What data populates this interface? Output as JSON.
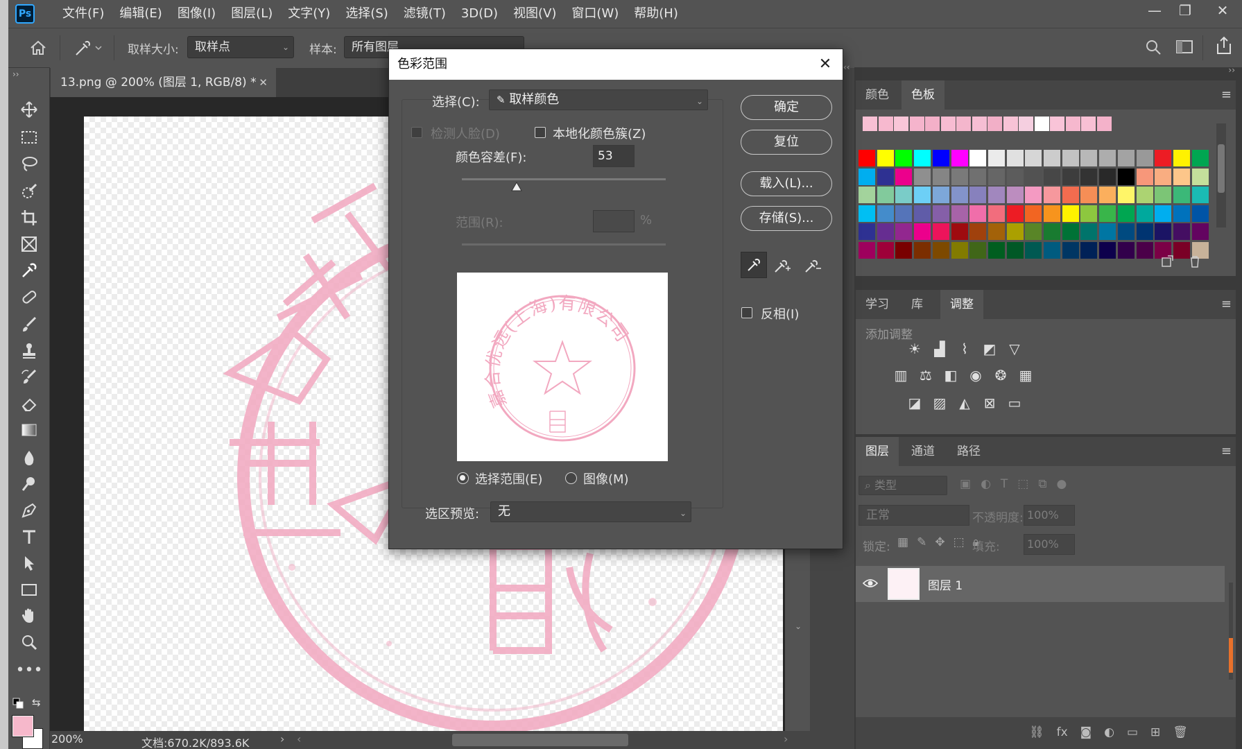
{
  "menubar": {
    "logo": "Ps",
    "items": [
      "文件(F)",
      "编辑(E)",
      "图像(I)",
      "图层(L)",
      "文字(Y)",
      "选择(S)",
      "滤镜(T)",
      "3D(D)",
      "视图(V)",
      "窗口(W)",
      "帮助(H)"
    ]
  },
  "options": {
    "sample_size_label": "取样大小:",
    "sample_size_value": "取样点",
    "sample_label": "样本:",
    "sample_value": "所有图层"
  },
  "document": {
    "tab_title": "13.png @ 200% (图层 1, RGB/8) *",
    "zoom": "200%",
    "doc_info": "文档:670.2K/893.6K"
  },
  "dialog": {
    "title": "色彩范围",
    "select_label": "选择(C):",
    "select_value": "取样颜色",
    "detect_faces": "检测人脸(D)",
    "localized_clusters": "本地化颜色簇(Z)",
    "fuzziness_label": "颜色容差(F):",
    "fuzziness_value": "53",
    "fuzziness_fraction": 0.27,
    "range_label": "范围(R):",
    "range_unit": "%",
    "radio_selection": "选择范围(E)",
    "radio_image": "图像(M)",
    "preview_label": "选区预览:",
    "preview_value": "无",
    "btn_ok": "确定",
    "btn_reset": "复位",
    "btn_load": "载入(L)...",
    "btn_save": "存储(S)...",
    "invert": "反相(I)"
  },
  "swatch_panel": {
    "tabs": [
      "颜色",
      "色板"
    ],
    "recent": [
      "#f8c0d4",
      "#f7b9cf",
      "#f9c6d8",
      "#f5b4cc",
      "#f3b0c8",
      "#f7bcd2",
      "#f4b6cc",
      "#f6bed3",
      "#f2afc7",
      "#f8c3d6",
      "#f5cfe0",
      "#ffffff",
      "#f9c4d8",
      "#f6b8ce",
      "#f8c0d4",
      "#f4b2ca"
    ],
    "grid": [
      [
        "#ff0000",
        "#ffff00",
        "#00ff00",
        "#00ffff",
        "#0000ff",
        "#ff00ff",
        "#ffffff",
        "#ebebeb",
        "#e0e0e0",
        "#d6d6d6",
        "#cccccc",
        "#c2c2c2",
        "#b8b8b8",
        "#adadad",
        "#a3a3a3",
        "#999999",
        "#ed1c24",
        "#fff200",
        "#00a651"
      ],
      [
        "#00aeef",
        "#2e3192",
        "#ec008c",
        "#8f8f8f",
        "#858585",
        "#7a7a7a",
        "#707070",
        "#666666",
        "#5c5c5c",
        "#525252",
        "#474747",
        "#3d3d3d",
        "#333333",
        "#292929",
        "#000000",
        "#f7977a",
        "#f9ad81",
        "#fdc68a",
        "#c4df9b"
      ],
      [
        "#a3d39c",
        "#82ca9c",
        "#7accc8",
        "#6dcff6",
        "#7da7d9",
        "#8393ca",
        "#8781bd",
        "#a187be",
        "#bc8dbf",
        "#f49ac2",
        "#f6989d",
        "#f26c4f",
        "#f68e56",
        "#fbaf5d",
        "#fff568",
        "#acd372",
        "#7cc576",
        "#3bb878",
        "#1abbb4"
      ],
      [
        "#00bff3",
        "#448ccb",
        "#5574b9",
        "#605ca8",
        "#855fa8",
        "#a763a8",
        "#f06eaa",
        "#f26d7d",
        "#ed1c24",
        "#f26522",
        "#f7941d",
        "#fff200",
        "#8dc73f",
        "#39b54a",
        "#00a651",
        "#00a99d",
        "#00aeef",
        "#0072bc",
        "#0054a6"
      ],
      [
        "#2e3192",
        "#662d91",
        "#92278f",
        "#ec008c",
        "#ed145b",
        "#9e0b0f",
        "#a0410d",
        "#a36209",
        "#aba000",
        "#598527",
        "#197b30",
        "#007236",
        "#00746b",
        "#0076a3",
        "#004a80",
        "#003471",
        "#1b1464",
        "#440e62",
        "#630460"
      ],
      [
        "#9e005d",
        "#9e0039",
        "#790000",
        "#7b2e00",
        "#7d4900",
        "#827b00",
        "#406618",
        "#005e20",
        "#005826",
        "#005952",
        "#005b7f",
        "#003663",
        "#002157",
        "#0d004c",
        "#32004b",
        "#4b0049",
        "#7b0046",
        "#7a0026",
        "#c7b299"
      ]
    ]
  },
  "adjust_panel": {
    "tabs": [
      "学习",
      "库",
      "调整"
    ],
    "add_label": "添加调整",
    "row1": [
      "brightness-icon",
      "levels-icon",
      "curves-icon",
      "exposure-icon",
      "vibrance-icon"
    ],
    "row2": [
      "hue-saturation-icon",
      "color-balance-icon",
      "black-white-icon",
      "photo-filter-icon",
      "channel-mixer-icon",
      "color-lookup-icon"
    ],
    "row3": [
      "invert-icon",
      "posterize-icon",
      "threshold-icon",
      "selective-color-icon",
      "gradient-map-icon"
    ]
  },
  "layers_panel": {
    "tabs": [
      "图层",
      "通道",
      "路径"
    ],
    "filter_placeholder": "类型",
    "blend_mode": "正常",
    "opacity_label": "不透明度:",
    "opacity_value": "100%",
    "lock_label": "锁定:",
    "fill_label": "填充:",
    "fill_value": "100%",
    "layer_name": "图层 1"
  },
  "colors": {
    "foreground": "#f6b8cb",
    "background": "#ffffff",
    "stamp": "#f2a8c0"
  },
  "stamp_text": {
    "ring": "嘉合优远(上海)有限公司"
  }
}
